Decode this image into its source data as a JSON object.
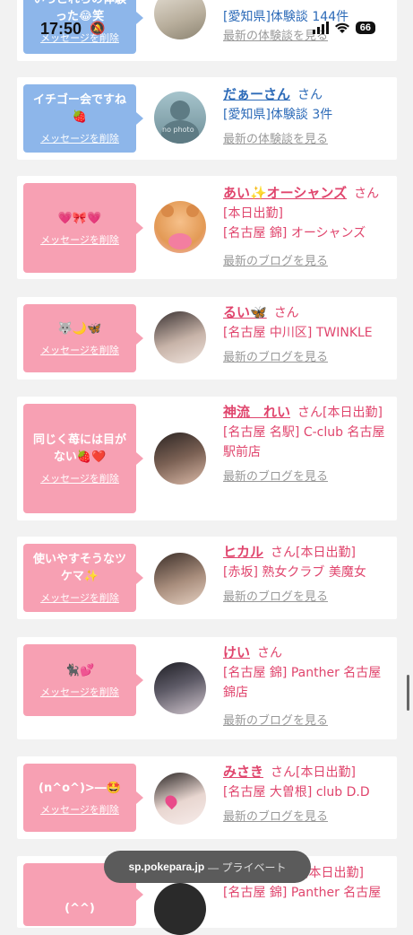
{
  "status_bar": {
    "time": "17:50",
    "battery": "66"
  },
  "cards": [
    {
      "bubble_color": "blue",
      "message": "いっこれらの体験 った😂笑",
      "delete_label": "メッセージを削除",
      "name": "",
      "honorific": "",
      "lines": [
        "[愛知県]体験談 144件"
      ],
      "link_label": "最新の体験談を見る",
      "text_color": "blue"
    },
    {
      "bubble_color": "blue",
      "message": "イチゴー会ですね🍓",
      "delete_label": "メッセージを削除",
      "name": "だぁーさん",
      "honorific": "さん",
      "lines": [
        "[愛知県]体験談 3件"
      ],
      "link_label": "最新の体験談を見る",
      "text_color": "blue",
      "avatar_text": "no photo"
    },
    {
      "bubble_color": "pink",
      "message": "💗🎀💗",
      "delete_label": "メッセージを削除",
      "name": "あい✨オーシャンズ",
      "honorific": "さん",
      "lines": [
        "[本日出勤]",
        "[名古屋 錦] オーシャンズ"
      ],
      "link_label": "最新のブログを見る",
      "text_color": "pink"
    },
    {
      "bubble_color": "pink",
      "message": "🐺🌙🦋",
      "delete_label": "メッセージを削除",
      "name": "るい🦋",
      "honorific": "さん",
      "lines": [
        "[名古屋 中川区] TWINKLE"
      ],
      "link_label": "最新のブログを見る",
      "text_color": "pink"
    },
    {
      "bubble_color": "pink",
      "message": "同じく苺には目がない🍓❤️",
      "delete_label": "メッセージを削除",
      "name": "神流　れい",
      "honorific": "さん[本日出勤]",
      "lines": [
        "[名古屋 名駅] C-club 名古屋駅前店"
      ],
      "link_label": "最新のブログを見る",
      "text_color": "pink"
    },
    {
      "bubble_color": "pink",
      "message": "使いやすそうなツケマ✨",
      "delete_label": "メッセージを削除",
      "name": "ヒカル",
      "honorific": "さん[本日出勤]",
      "lines": [
        "[赤坂] 熟女クラブ 美魔女"
      ],
      "link_label": "最新のブログを見る",
      "text_color": "pink"
    },
    {
      "bubble_color": "pink",
      "message": "🐈‍⬛💕",
      "delete_label": "メッセージを削除",
      "name": "けい",
      "honorific": "さん",
      "lines": [
        "[名古屋 錦] Panther 名古屋錦店"
      ],
      "link_label": "最新のブログを見る",
      "text_color": "pink"
    },
    {
      "bubble_color": "pink",
      "message": "(n^o^)>―🤩",
      "delete_label": "メッセージを削除",
      "name": "みさき",
      "honorific": "さん[本日出勤]",
      "lines": [
        "[名古屋 大曽根] club D.D"
      ],
      "link_label": "最新のブログを見る",
      "text_color": "pink"
    },
    {
      "bubble_color": "pink",
      "message": "(^^)",
      "delete_label": "",
      "name": "",
      "honorific": "[本日出勤]",
      "lines": [
        "[名古屋 錦] Panther 名古屋"
      ],
      "link_label": "",
      "text_color": "pink"
    }
  ],
  "url_bar": {
    "host": "sp.pokepara.jp",
    "mode": "— プライベート"
  }
}
